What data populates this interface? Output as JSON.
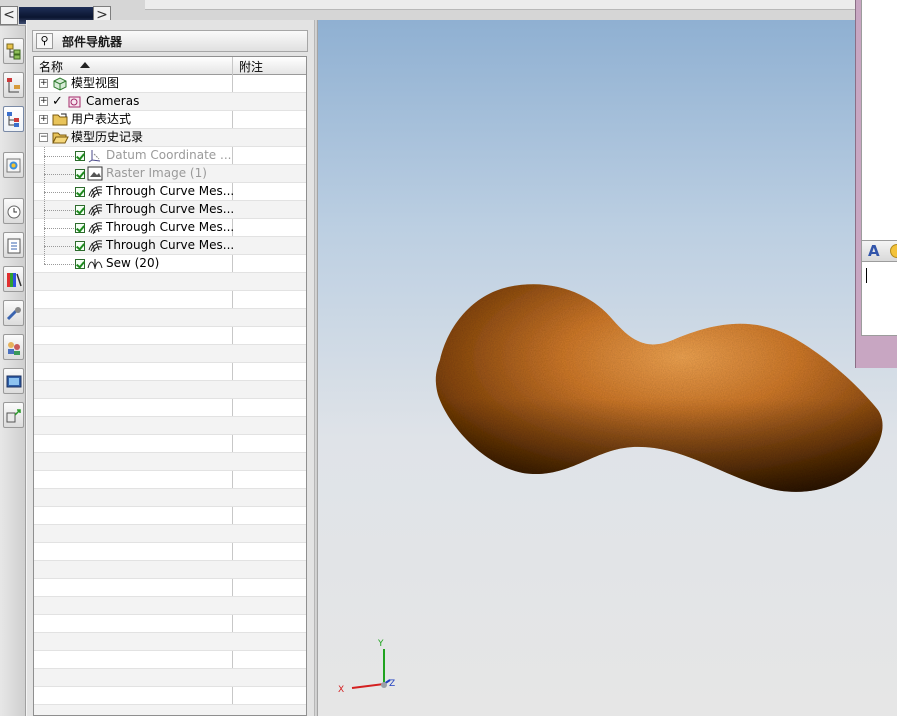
{
  "toolbar": {
    "nav_left_glyph": "<",
    "nav_right_glyph": ">"
  },
  "resource_bar": {
    "items": [
      {
        "icon": "assembly-navigator-icon"
      },
      {
        "icon": "constraint-navigator-icon"
      },
      {
        "icon": "part-navigator-icon"
      },
      {
        "icon": "reuse-library-icon"
      },
      {
        "icon": "history-icon"
      },
      {
        "icon": "system-materials-icon"
      },
      {
        "icon": "process-studio-icon"
      },
      {
        "icon": "manufacturing-wizard-icon"
      },
      {
        "icon": "roles-icon"
      },
      {
        "icon": "system-scene-icon"
      },
      {
        "icon": "kinematics-icon"
      }
    ]
  },
  "navigator": {
    "title": "部件导航器",
    "pin_glyph": "⚲",
    "columns": {
      "name": "名称",
      "comment": "附注"
    },
    "top_nodes": [
      {
        "label": "模型视图",
        "icon": "model-views-icon",
        "expander": "+"
      },
      {
        "label": "Cameras",
        "icon": "cameras-icon",
        "expander": "+",
        "checkmark": "✓"
      },
      {
        "label": "用户表达式",
        "icon": "folder-icon",
        "expander": "+"
      },
      {
        "label": "模型历史记录",
        "icon": "open-folder-icon",
        "expander": "−"
      }
    ],
    "history": [
      {
        "label": "Datum Coordinate ...",
        "icon": "datum-csys-icon",
        "suppressed": true
      },
      {
        "label": "Raster Image (1)",
        "icon": "raster-image-icon",
        "suppressed": true
      },
      {
        "label": "Through Curve Mes...",
        "icon": "through-curve-mesh-icon",
        "suppressed": false
      },
      {
        "label": "Through Curve Mes...",
        "icon": "through-curve-mesh-icon",
        "suppressed": false
      },
      {
        "label": "Through Curve Mes...",
        "icon": "through-curve-mesh-icon",
        "suppressed": false
      },
      {
        "label": "Through Curve Mes...",
        "icon": "through-curve-mesh-icon",
        "suppressed": false
      },
      {
        "label": "Sew (20)",
        "icon": "sew-icon",
        "suppressed": false
      }
    ]
  },
  "viewport": {
    "axis_x": "X",
    "axis_y": "Y",
    "axis_z": "Z",
    "colors": {
      "x_axis": "#d42020",
      "y_axis": "#1fa31f",
      "z_axis": "#2040c0",
      "body": "#c8742a"
    }
  },
  "dialog": {
    "font_button": "A",
    "emoji_icon": "smiley-icon"
  }
}
